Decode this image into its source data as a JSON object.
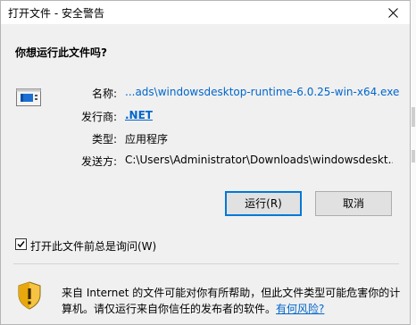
{
  "window": {
    "title": "打开文件 - 安全警告"
  },
  "question": "你想运行此文件吗?",
  "fields": {
    "name_label": "名称:",
    "name_value": "...ads\\windowsdesktop-runtime-6.0.25-win-x64.exe",
    "publisher_label": "发行商:",
    "publisher_value": ".NET",
    "type_label": "类型:",
    "type_value": "应用程序",
    "from_label": "发送方:",
    "from_value": "C:\\Users\\Administrator\\Downloads\\windowsdeskt..."
  },
  "buttons": {
    "run_label": "运行(R)",
    "cancel_label": "取消"
  },
  "checkbox": {
    "label": "打开此文件前总是询问(W)",
    "checked": true
  },
  "warning": {
    "text": "来自 Internet 的文件可能对你有所帮助，但此文件类型可能危害你的计算机。请仅运行来自你信任的发布者的软件。",
    "link": "有何风险?"
  },
  "colors": {
    "link": "#0066cc",
    "default_button_border": "#0078d7",
    "dialog_bg": "#f0f0f0"
  }
}
